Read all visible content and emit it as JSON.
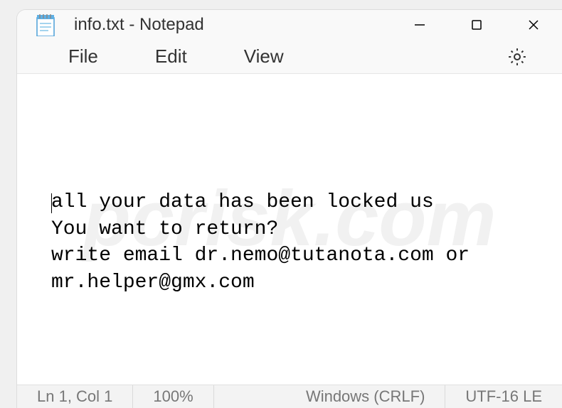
{
  "window": {
    "title": "info.txt - Notepad"
  },
  "menu": {
    "file": "File",
    "edit": "Edit",
    "view": "View"
  },
  "content": {
    "text": "all your data has been locked us\nYou want to return?\nwrite email dr.nemo@tutanota.com or mr.helper@gmx.com"
  },
  "statusbar": {
    "position": "Ln 1, Col 1",
    "zoom": "100%",
    "line_ending": "Windows (CRLF)",
    "encoding": "UTF-16 LE"
  },
  "watermark": "pcrisk.com"
}
